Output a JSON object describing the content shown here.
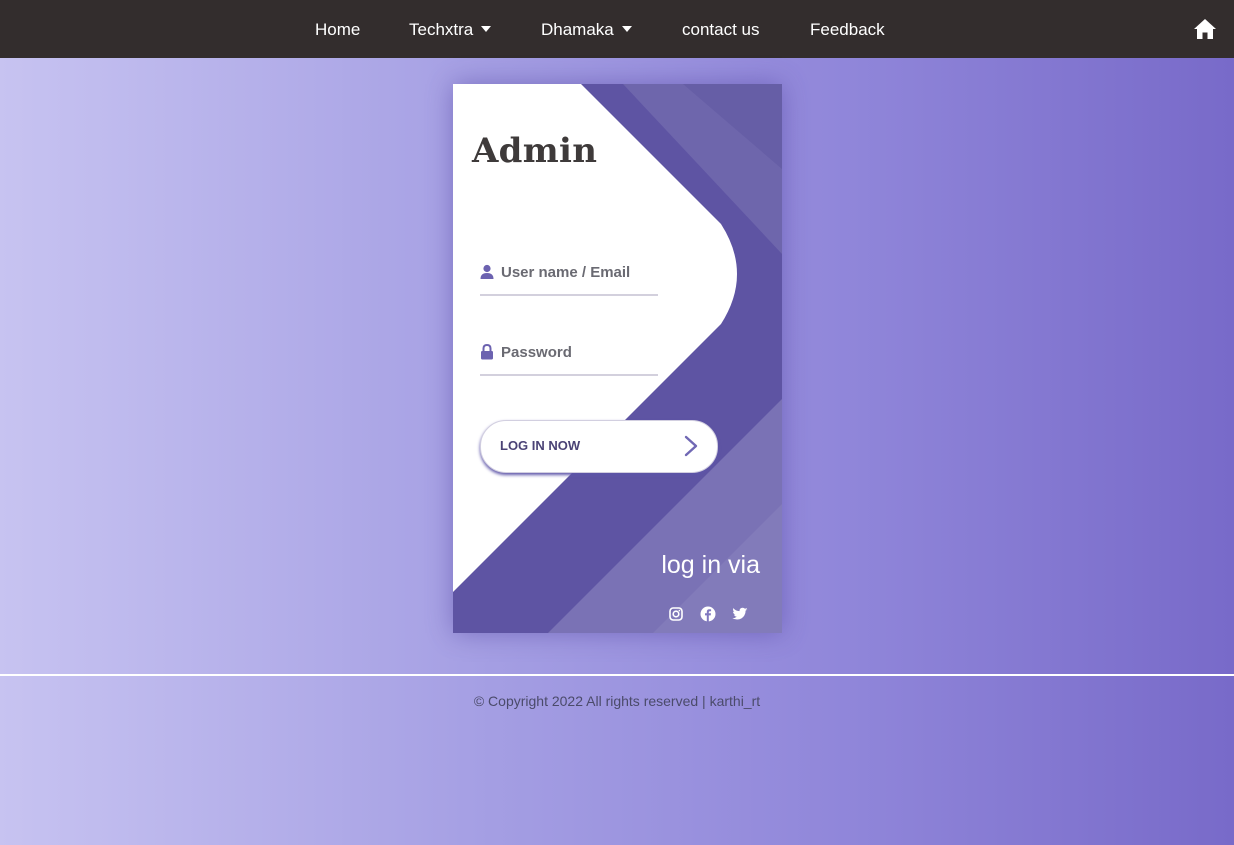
{
  "nav": {
    "items": [
      {
        "label": "Home"
      },
      {
        "label": "Techxtra",
        "dropdown": true
      },
      {
        "label": "Dhamaka",
        "dropdown": true
      },
      {
        "label": "contact us"
      },
      {
        "label": "Feedback"
      }
    ],
    "home_icon": "home-icon"
  },
  "login": {
    "title": "Admin",
    "username_placeholder": "User name / Email",
    "password_placeholder": "Password",
    "username_value": "",
    "password_value": "",
    "button_label": "LOG IN NOW",
    "via_label": "log in via",
    "social": [
      "instagram-icon",
      "facebook-icon",
      "twitter-icon"
    ]
  },
  "footer": {
    "text": "© Copyright  2022 All rights reserved | karthi_rt"
  },
  "colors": {
    "navbar": "#332d2d",
    "accent": "#5b509f",
    "bg_left": "#c7c3f1",
    "bg_right": "#786ac9"
  }
}
